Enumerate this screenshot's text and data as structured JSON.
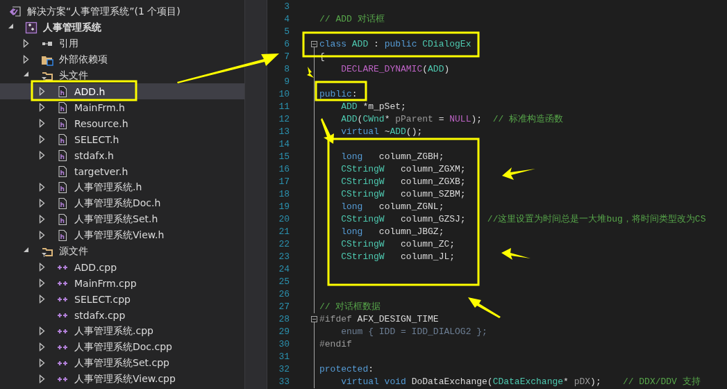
{
  "solution_explorer": {
    "items": [
      {
        "label": "解决方案“人事管理系统”(1 个项目)",
        "kind": "solution",
        "selected": false,
        "children": [
          {
            "label": "人事管理系统",
            "kind": "project",
            "has_children": true,
            "expanded": true,
            "selected": false,
            "children": [
              {
                "label": "引用",
                "kind": "references",
                "has_children": true,
                "expanded": false,
                "selected": false
              },
              {
                "label": "外部依赖项",
                "kind": "external",
                "has_children": true,
                "expanded": false,
                "selected": false
              },
              {
                "label": "头文件",
                "kind": "filter",
                "has_children": true,
                "expanded": true,
                "selected": false,
                "children": [
                  {
                    "label": "ADD.h",
                    "kind": "header",
                    "has_children": true,
                    "expanded": false,
                    "selected": true
                  },
                  {
                    "label": "MainFrm.h",
                    "kind": "header",
                    "has_children": true,
                    "expanded": false,
                    "selected": false
                  },
                  {
                    "label": "Resource.h",
                    "kind": "header",
                    "has_children": true,
                    "expanded": false,
                    "selected": false
                  },
                  {
                    "label": "SELECT.h",
                    "kind": "header",
                    "has_children": true,
                    "expanded": false,
                    "selected": false
                  },
                  {
                    "label": "stdafx.h",
                    "kind": "header",
                    "has_children": true,
                    "expanded": false,
                    "selected": false
                  },
                  {
                    "label": "targetver.h",
                    "kind": "header",
                    "has_children": false,
                    "selected": false
                  },
                  {
                    "label": "人事管理系统.h",
                    "kind": "header",
                    "has_children": true,
                    "expanded": false,
                    "selected": false
                  },
                  {
                    "label": "人事管理系统Doc.h",
                    "kind": "header",
                    "has_children": true,
                    "expanded": false,
                    "selected": false
                  },
                  {
                    "label": "人事管理系统Set.h",
                    "kind": "header",
                    "has_children": true,
                    "expanded": false,
                    "selected": false
                  },
                  {
                    "label": "人事管理系统View.h",
                    "kind": "header",
                    "has_children": true,
                    "expanded": false,
                    "selected": false
                  }
                ]
              },
              {
                "label": "源文件",
                "kind": "filter",
                "has_children": true,
                "expanded": true,
                "selected": false,
                "children": [
                  {
                    "label": "ADD.cpp",
                    "kind": "source",
                    "has_children": true,
                    "expanded": false,
                    "selected": false
                  },
                  {
                    "label": "MainFrm.cpp",
                    "kind": "source",
                    "has_children": true,
                    "expanded": false,
                    "selected": false
                  },
                  {
                    "label": "SELECT.cpp",
                    "kind": "source",
                    "has_children": true,
                    "expanded": false,
                    "selected": false
                  },
                  {
                    "label": "stdafx.cpp",
                    "kind": "source",
                    "has_children": false,
                    "selected": false
                  },
                  {
                    "label": "人事管理系统.cpp",
                    "kind": "source",
                    "has_children": true,
                    "expanded": false,
                    "selected": false
                  },
                  {
                    "label": "人事管理系统Doc.cpp",
                    "kind": "source",
                    "has_children": true,
                    "expanded": false,
                    "selected": false
                  },
                  {
                    "label": "人事管理系统Set.cpp",
                    "kind": "source",
                    "has_children": true,
                    "expanded": false,
                    "selected": false
                  },
                  {
                    "label": "人事管理系统View.cpp",
                    "kind": "source",
                    "has_children": true,
                    "expanded": false,
                    "selected": false
                  }
                ]
              }
            ]
          }
        ]
      }
    ]
  },
  "editor": {
    "lines": [
      {
        "number": "3",
        "fold_toggle": false
      },
      {
        "number": "4",
        "fold_toggle": false,
        "tokens": [
          {
            "kind": "comment",
            "text": "// ADD 对话框"
          }
        ]
      },
      {
        "number": "5",
        "fold_toggle": false
      },
      {
        "number": "6",
        "fold_toggle": true,
        "tokens": [
          {
            "kind": "keyword",
            "text": "class "
          },
          {
            "kind": "type",
            "text": "ADD"
          },
          {
            "kind": "plain",
            "text": " : "
          },
          {
            "kind": "keyword",
            "text": "public "
          },
          {
            "kind": "type",
            "text": "CDialogEx"
          }
        ]
      },
      {
        "number": "7",
        "fold_toggle": false,
        "tokens": [
          {
            "kind": "plain",
            "text": "{"
          }
        ]
      },
      {
        "number": "8",
        "fold_toggle": false,
        "tokens": [
          {
            "kind": "macro",
            "text": "    DECLARE_DYNAMIC"
          },
          {
            "kind": "plain",
            "text": "("
          },
          {
            "kind": "type",
            "text": "ADD"
          },
          {
            "kind": "plain",
            "text": ")"
          }
        ]
      },
      {
        "number": "9",
        "fold_toggle": false
      },
      {
        "number": "10",
        "fold_toggle": false,
        "tokens": [
          {
            "kind": "keyword",
            "text": "public"
          },
          {
            "kind": "plain",
            "text": ":"
          }
        ]
      },
      {
        "number": "11",
        "fold_toggle": false,
        "tokens": [
          {
            "kind": "type",
            "text": "    ADD"
          },
          {
            "kind": "plain",
            "text": " *m_pSet;"
          }
        ]
      },
      {
        "number": "12",
        "fold_toggle": false,
        "tokens": [
          {
            "kind": "type",
            "text": "    ADD"
          },
          {
            "kind": "plain",
            "text": "("
          },
          {
            "kind": "type",
            "text": "CWnd"
          },
          {
            "kind": "plain",
            "text": "* "
          },
          {
            "kind": "param",
            "text": "pParent"
          },
          {
            "kind": "plain",
            "text": " = "
          },
          {
            "kind": "macro",
            "text": "NULL"
          },
          {
            "kind": "plain",
            "text": ");  "
          },
          {
            "kind": "comment",
            "text": "// 标准构造函数"
          }
        ]
      },
      {
        "number": "13",
        "fold_toggle": false,
        "tokens": [
          {
            "kind": "keyword",
            "text": "    virtual"
          },
          {
            "kind": "plain",
            "text": " ~"
          },
          {
            "kind": "type",
            "text": "ADD"
          },
          {
            "kind": "plain",
            "text": "();"
          }
        ]
      },
      {
        "number": "14",
        "fold_toggle": false
      },
      {
        "number": "15",
        "fold_toggle": false,
        "tokens": [
          {
            "kind": "keyword",
            "text": "    long"
          },
          {
            "kind": "plain",
            "text": "   column_ZGBH;"
          }
        ]
      },
      {
        "number": "16",
        "fold_toggle": false,
        "tokens": [
          {
            "kind": "type",
            "text": "    CStringW"
          },
          {
            "kind": "plain",
            "text": "   column_ZGXM;"
          }
        ]
      },
      {
        "number": "17",
        "fold_toggle": false,
        "tokens": [
          {
            "kind": "type",
            "text": "    CStringW"
          },
          {
            "kind": "plain",
            "text": "   column_ZGXB;"
          }
        ]
      },
      {
        "number": "18",
        "fold_toggle": false,
        "tokens": [
          {
            "kind": "type",
            "text": "    CStringW"
          },
          {
            "kind": "plain",
            "text": "   column_SZBM;"
          }
        ]
      },
      {
        "number": "19",
        "fold_toggle": false,
        "tokens": [
          {
            "kind": "keyword",
            "text": "    long"
          },
          {
            "kind": "plain",
            "text": "   column_ZGNL;"
          }
        ]
      },
      {
        "number": "20",
        "fold_toggle": false,
        "tokens": [
          {
            "kind": "type",
            "text": "    CStringW"
          },
          {
            "kind": "plain",
            "text": "   column_GZSJ;    "
          },
          {
            "kind": "comment",
            "text": "//这里设置为时间总是一大堆bug，将时间类型改为CS"
          }
        ]
      },
      {
        "number": "21",
        "fold_toggle": false,
        "tokens": [
          {
            "kind": "keyword",
            "text": "    long"
          },
          {
            "kind": "plain",
            "text": "   column_JBGZ;"
          }
        ]
      },
      {
        "number": "22",
        "fold_toggle": false,
        "tokens": [
          {
            "kind": "type",
            "text": "    CStringW"
          },
          {
            "kind": "plain",
            "text": "   column_ZC;"
          }
        ]
      },
      {
        "number": "23",
        "fold_toggle": false,
        "tokens": [
          {
            "kind": "type",
            "text": "    CStringW"
          },
          {
            "kind": "plain",
            "text": "   column_JL;"
          }
        ]
      },
      {
        "number": "24",
        "fold_toggle": false
      },
      {
        "number": "25",
        "fold_toggle": false
      },
      {
        "number": "26",
        "fold_toggle": false
      },
      {
        "number": "27",
        "fold_toggle": false,
        "tokens": [
          {
            "kind": "comment",
            "text": "// 对话框数据"
          }
        ]
      },
      {
        "number": "28",
        "fold_toggle": true,
        "tokens": [
          {
            "kind": "preproc",
            "text": "#ifdef"
          },
          {
            "kind": "plain",
            "text": " AFX_DESIGN_TIME"
          }
        ]
      },
      {
        "number": "29",
        "fold_toggle": false,
        "tokens": [
          {
            "kind": "inactive",
            "text": "    enum { IDD = IDD_DIALOG2 };"
          }
        ]
      },
      {
        "number": "30",
        "fold_toggle": false,
        "tokens": [
          {
            "kind": "preproc",
            "text": "#endif"
          }
        ]
      },
      {
        "number": "31",
        "fold_toggle": false
      },
      {
        "number": "32",
        "fold_toggle": false,
        "tokens": [
          {
            "kind": "keyword",
            "text": "protected"
          },
          {
            "kind": "plain",
            "text": ":"
          }
        ]
      },
      {
        "number": "33",
        "fold_toggle": false,
        "tokens": [
          {
            "kind": "keyword",
            "text": "    virtual void"
          },
          {
            "kind": "plain",
            "text": " DoDataExchange("
          },
          {
            "kind": "type",
            "text": "CDataExchange"
          },
          {
            "kind": "plain",
            "text": "* "
          },
          {
            "kind": "param",
            "text": "pDX"
          },
          {
            "kind": "plain",
            "text": ");    "
          },
          {
            "kind": "comment",
            "text": "// DDX/DDV 支持"
          }
        ]
      }
    ]
  }
}
